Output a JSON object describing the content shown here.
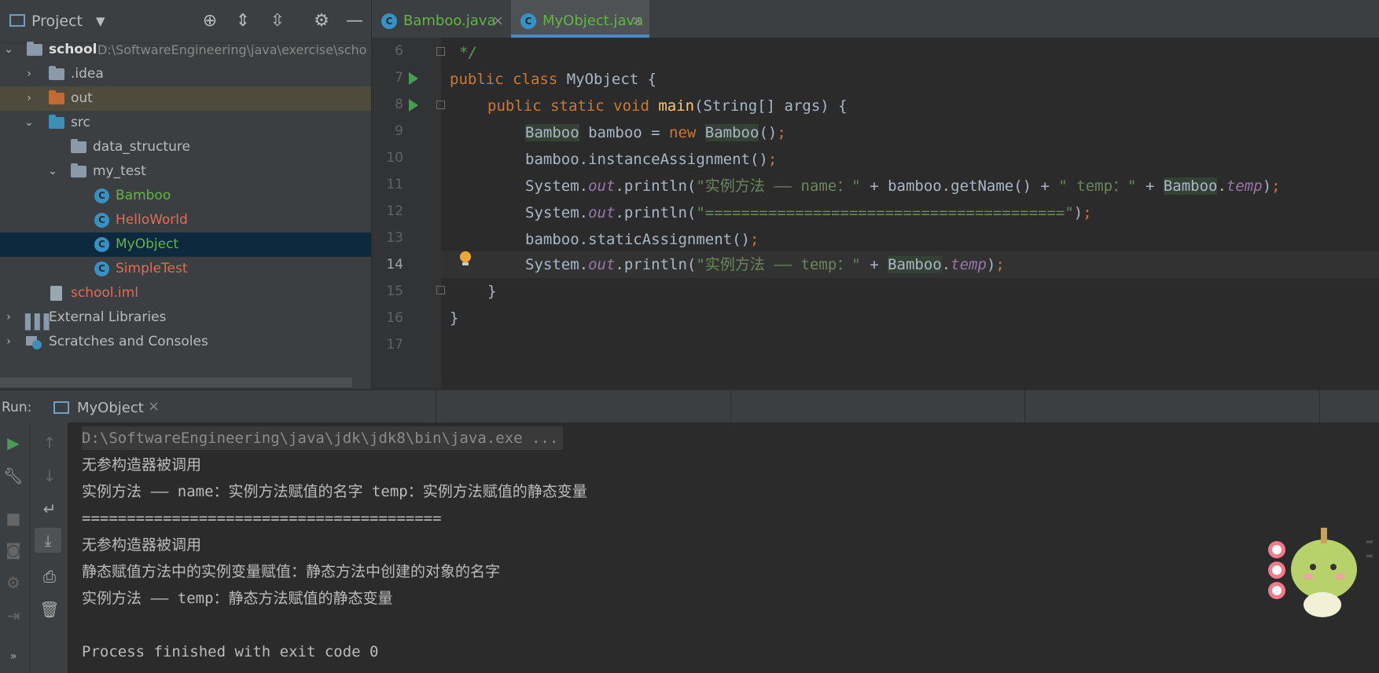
{
  "project_panel": {
    "title": "Project",
    "tree": [
      {
        "label": "school",
        "sub": "D:\\SoftwareEngineering\\java\\exercise\\scho",
        "expanded": true
      },
      {
        "label": ".idea"
      },
      {
        "label": "out"
      },
      {
        "label": "src",
        "expanded": true
      },
      {
        "label": "data_structure"
      },
      {
        "label": "my_test",
        "expanded": true
      },
      {
        "label": "Bamboo"
      },
      {
        "label": "HelloWorld"
      },
      {
        "label": "MyObject"
      },
      {
        "label": "SimpleTest"
      },
      {
        "label": "school.iml"
      },
      {
        "label": "External Libraries"
      },
      {
        "label": "Scratches and Consoles"
      }
    ]
  },
  "editor": {
    "tabs": [
      {
        "label": "Bamboo.java",
        "icon_letter": "C"
      },
      {
        "label": "MyObject.java",
        "icon_letter": "C"
      }
    ],
    "line_numbers": [
      "6",
      "7",
      "8",
      "9",
      "10",
      "11",
      "12",
      "13",
      "14",
      "15",
      "16",
      "17"
    ],
    "code": {
      "l6": "*/",
      "l7_kw": "public class ",
      "l7_rest": "MyObject {",
      "l8_kw1": "public static void ",
      "l8_fn": "main",
      "l8_rest": "(String[] args) {",
      "l9_cls1": "Bamboo",
      "l9_mid": " bamboo = ",
      "l9_kw": "new ",
      "l9_cls2": "Bamboo",
      "l9_end": "()",
      "l10": "bamboo.instanceAssignment()",
      "l11_a": "System.",
      "l11_out": "out",
      "l11_b": ".println(",
      "l11_s1": "\"实例方法 —— name：\"",
      "l11_c": " + bamboo.getName() + ",
      "l11_s2": "\" temp：\"",
      "l11_d": " + ",
      "l11_cls": "Bamboo",
      "l11_dot": ".",
      "l11_fld": "temp",
      "l12_a": "System.",
      "l12_out": "out",
      "l12_b": ".println(",
      "l12_s": "\"========================================\"",
      "l12_c": ")",
      "l13": "bamboo.staticAssignment()",
      "l14_a": "System.",
      "l14_out": "out",
      "l14_b": ".println(",
      "l14_s": "\"实例方法 —— temp：\"",
      "l14_c": " + ",
      "l14_cls": "Bamboo",
      "l14_dot": ".",
      "l14_fld": "temp",
      "l14_end": ")",
      "l15": "}",
      "l16": "}",
      "semi": ";",
      "close_paren": ")"
    }
  },
  "run_panel": {
    "label": "Run:",
    "tab": "MyObject",
    "console": [
      "D:\\SoftwareEngineering\\java\\jdk\\jdk8\\bin\\java.exe ...",
      "无参构造器被调用",
      "实例方法 —— name：实例方法赋值的名字 temp：实例方法赋值的静态变量",
      "========================================",
      "无参构造器被调用",
      "静态赋值方法中的实例变量赋值：静态方法中创建的对象的名字",
      "实例方法 —— temp：静态方法赋值的静态变量",
      "",
      "Process finished with exit code 0"
    ]
  },
  "colors": {
    "accent": "#4a88c7",
    "keyword": "#cc7832",
    "string": "#6a8759",
    "field": "#9876aa",
    "function": "#ffc66d",
    "class_green": "#62b543",
    "error_red": "#e06c55"
  }
}
